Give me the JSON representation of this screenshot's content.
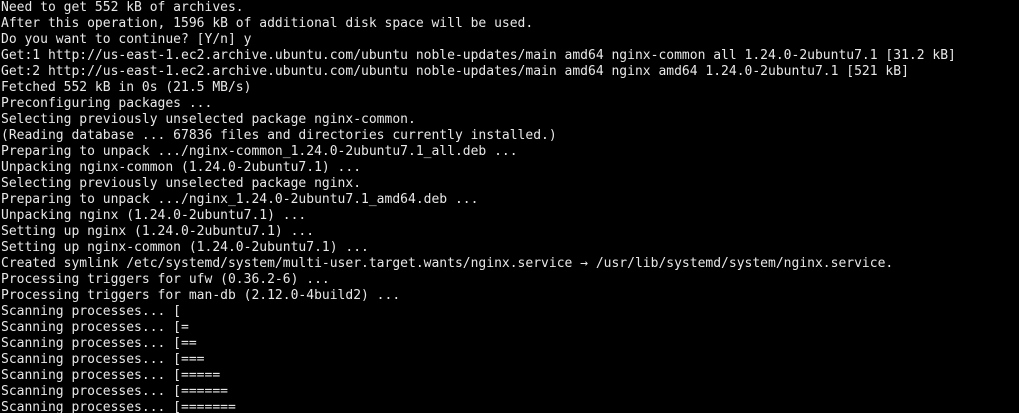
{
  "terminal": {
    "lines": [
      "Need to get 552 kB of archives.",
      "After this operation, 1596 kB of additional disk space will be used.",
      "Do you want to continue? [Y/n] y",
      "Get:1 http://us-east-1.ec2.archive.ubuntu.com/ubuntu noble-updates/main amd64 nginx-common all 1.24.0-2ubuntu7.1 [31.2 kB]",
      "Get:2 http://us-east-1.ec2.archive.ubuntu.com/ubuntu noble-updates/main amd64 nginx amd64 1.24.0-2ubuntu7.1 [521 kB]",
      "Fetched 552 kB in 0s (21.5 MB/s)",
      "Preconfiguring packages ...",
      "Selecting previously unselected package nginx-common.",
      "(Reading database ... 67836 files and directories currently installed.)",
      "Preparing to unpack .../nginx-common_1.24.0-2ubuntu7.1_all.deb ...",
      "Unpacking nginx-common (1.24.0-2ubuntu7.1) ...",
      "Selecting previously unselected package nginx.",
      "Preparing to unpack .../nginx_1.24.0-2ubuntu7.1_amd64.deb ...",
      "Unpacking nginx (1.24.0-2ubuntu7.1) ...",
      "Setting up nginx (1.24.0-2ubuntu7.1) ...",
      "Setting up nginx-common (1.24.0-2ubuntu7.1) ...",
      "Created symlink /etc/systemd/system/multi-user.target.wants/nginx.service → /usr/lib/systemd/system/nginx.service.",
      "Processing triggers for ufw (0.36.2-6) ...",
      "Processing triggers for man-db (2.12.0-4build2) ...",
      "Scanning processes... [",
      "Scanning processes... [=",
      "Scanning processes... [==",
      "Scanning processes... [===",
      "Scanning processes... [=====",
      "Scanning processes... [======",
      "Scanning processes... [======="
    ],
    "colors": {
      "background": "#000000",
      "foreground": "#e8e8e8"
    }
  }
}
